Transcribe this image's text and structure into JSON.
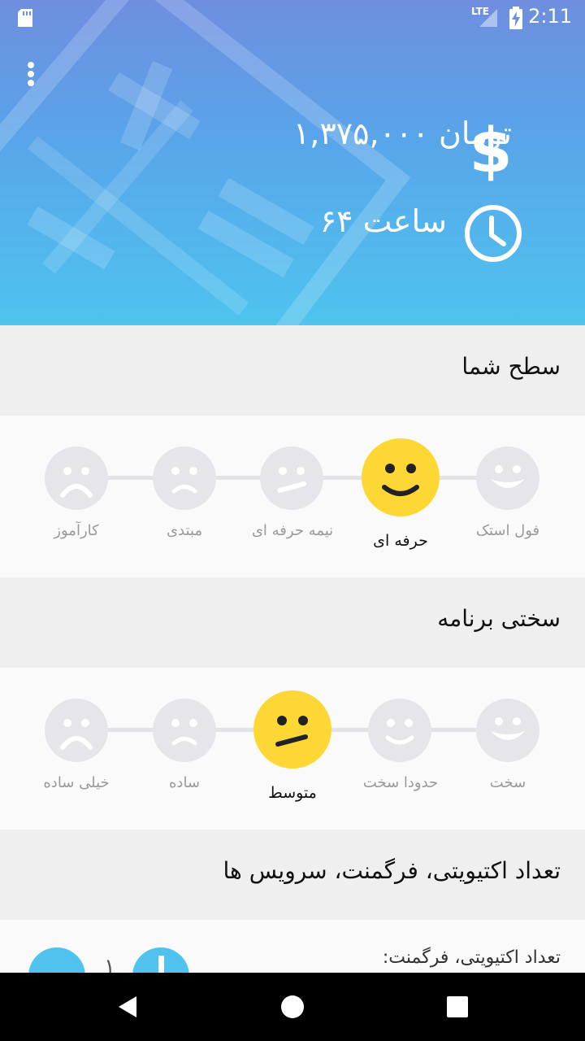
{
  "status_bar": {
    "network": "LTE",
    "time": "2:11"
  },
  "header": {
    "price": "۱,۳۷۵,۰۰۰ تومان",
    "hours": "۶۴ ساعت"
  },
  "level_section": {
    "title": "سطح شما",
    "options": [
      {
        "label": "فول استک",
        "face": "big-smile"
      },
      {
        "label": "حرفه ای",
        "face": "smile",
        "selected": true
      },
      {
        "label": "نیمه حرفه ای",
        "face": "meh"
      },
      {
        "label": "مبتدی",
        "face": "sad"
      },
      {
        "label": "کارآموز",
        "face": "very-sad"
      }
    ]
  },
  "difficulty_section": {
    "title": "سختی برنامه",
    "options": [
      {
        "label": "سخت",
        "face": "big-smile"
      },
      {
        "label": "حدودا سخت",
        "face": "smile"
      },
      {
        "label": "متوسط",
        "face": "meh",
        "selected": true
      },
      {
        "label": "ساده",
        "face": "sad"
      },
      {
        "label": "خیلی ساده",
        "face": "very-sad"
      }
    ]
  },
  "count_section": {
    "title": "تعداد اکتیویتی، فرگمنت، سرویس ها",
    "field_label": "تعداد اکتیویتی، فرگمنت:",
    "value": "۱"
  },
  "colors": {
    "header_top": "#6f8ee0",
    "header_bottom": "#4ec4ee",
    "selected_face": "#fdd835",
    "inactive_face": "#e6e6ea",
    "accent": "#4fc3ee"
  }
}
